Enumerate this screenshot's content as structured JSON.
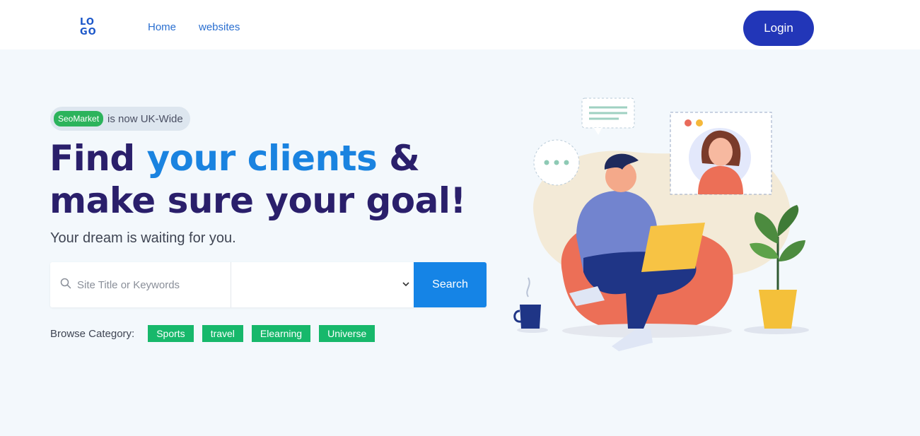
{
  "header": {
    "logo_top": "LO",
    "logo_bottom": "GO",
    "nav": [
      {
        "label": "Home"
      },
      {
        "label": "websites"
      }
    ],
    "login_label": "Login"
  },
  "hero": {
    "badge_pill": "SeoMarket",
    "badge_text": "is now UK-Wide",
    "headline_1a": "Find ",
    "headline_1b": "your clients",
    "headline_1c": " &",
    "headline_2": "make sure your goal!",
    "subtitle": "Your dream is waiting for you."
  },
  "search": {
    "placeholder": "Site Title or Keywords",
    "select_value": "",
    "button_label": "Search"
  },
  "browse": {
    "label": "Browse Category:",
    "categories": [
      "Sports",
      "travel",
      "Elearning",
      "Universe"
    ]
  },
  "colors": {
    "brand_blue": "#2236b8",
    "accent_blue": "#1a83e0",
    "heading_purple": "#2a1f6b",
    "tag_green": "#17b86b"
  }
}
